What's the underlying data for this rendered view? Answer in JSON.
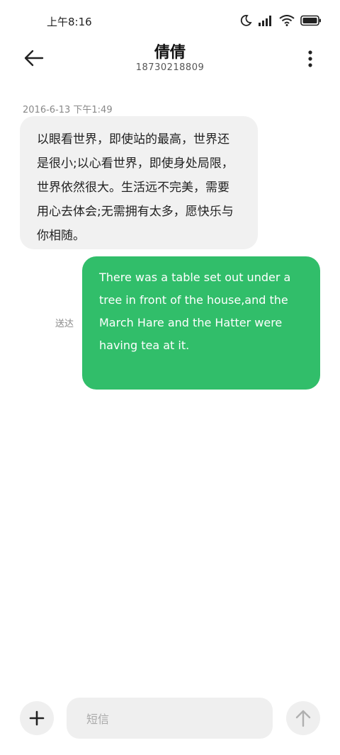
{
  "status_bar": {
    "time": "上午8:16",
    "icons": [
      "moon-icon",
      "signal-icon",
      "wifi-icon",
      "battery-icon"
    ]
  },
  "header": {
    "contact_name": "倩倩",
    "contact_number": "18730218809",
    "back_icon": "back-arrow-icon",
    "menu_icon": "more-vertical-icon"
  },
  "conversation": {
    "timestamp": "2016-6-13 下午1:49",
    "messages": [
      {
        "direction": "incoming",
        "text": "以眼看世界，即使站的最高，世界还是很小;以心看世界，即使身处局限，世界依然很大。生活远不完美，需要用心去体会;无需拥有太多，愿快乐与你相随。"
      },
      {
        "direction": "outgoing",
        "text": "There was a table set out under a tree in front of the house,and the March Hare and the Hatter were having tea at it.",
        "status": "送达"
      }
    ]
  },
  "composer": {
    "placeholder": "短信",
    "add_icon": "plus-icon",
    "send_icon": "arrow-up-icon"
  },
  "colors": {
    "outgoing_bubble": "#31be6a",
    "incoming_bubble": "#f1f1f1",
    "background": "#ffffff"
  }
}
